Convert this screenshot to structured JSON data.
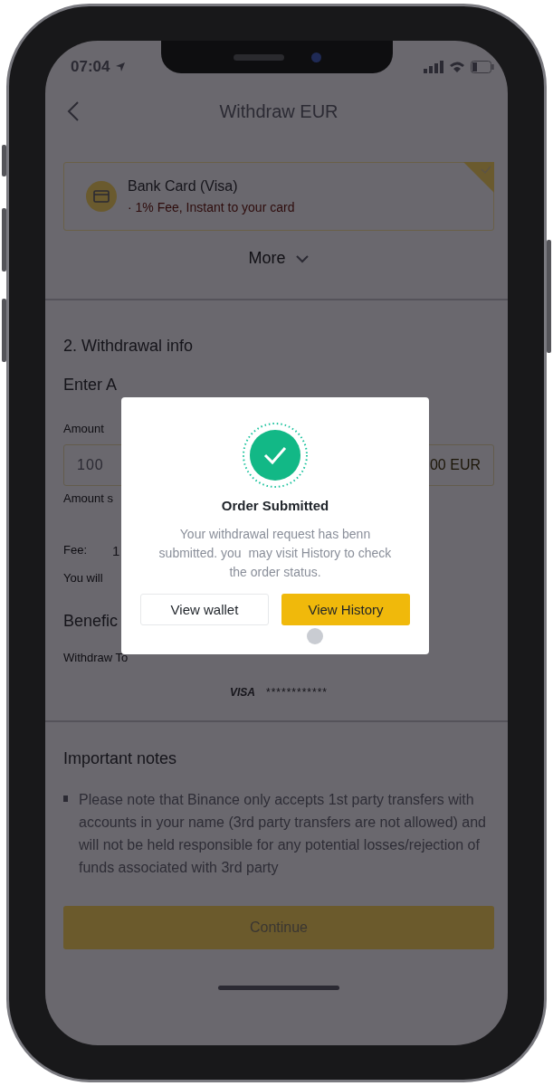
{
  "status_bar": {
    "time": "07:04"
  },
  "header": {
    "title": "Withdraw EUR"
  },
  "payment_method": {
    "name": "Bank Card (Visa)",
    "note": "· 1% Fee, Instant to your card",
    "selected": true
  },
  "more_label": "More",
  "withdrawal_info": {
    "heading": "2. Withdrawal info",
    "amount_heading": "Enter A",
    "amount_label": "Amount",
    "amount_value": "100",
    "amount_unit": "00 EUR",
    "amount_hint": "Amount s",
    "fee_label": "Fee:",
    "fee_value": "1",
    "receive_label": "You will",
    "beneficiary_heading": "Benefic",
    "withdraw_to_label": "Withdraw To",
    "card_brand": "VISA",
    "card_number": "************"
  },
  "notes": {
    "heading": "Important notes",
    "items": [
      "Please note that Binance only accepts 1st party transfers with accounts in your name (3rd party transfers are not allowed) and will not be held responsible for any potential losses/rejection of funds associated with 3rd party"
    ]
  },
  "continue_button": "Continue",
  "dialog": {
    "title": "Order Submitted",
    "message": "Your withdrawal request has benn submitted. you  may visit History to check the order status.",
    "buttons": [
      {
        "label": "View wallet",
        "kind": "secondary"
      },
      {
        "label": "View History",
        "kind": "primary"
      }
    ]
  }
}
